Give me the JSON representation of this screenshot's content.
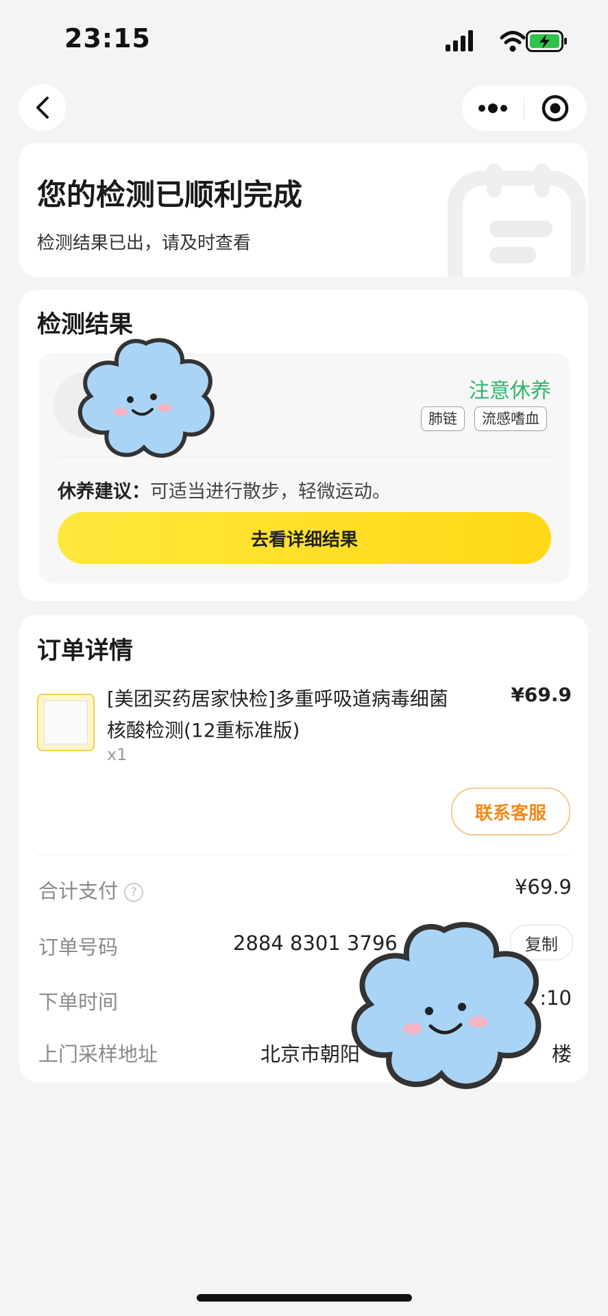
{
  "status_bar": {
    "time": "23:15"
  },
  "header": {
    "back_icon": "chevron-left-icon",
    "menu_icon": "more-dots-icon",
    "close_icon": "target-circle-icon"
  },
  "banner": {
    "title": "您的检测已顺利完成",
    "subtitle": "检测结果已出，请及时查看"
  },
  "result": {
    "section_title": "检测结果",
    "status": "注意休养",
    "status_color": "#2fb46c",
    "tags": [
      "肺链",
      "流感嗜血"
    ],
    "advice_label": "休养建议：",
    "advice_text": "可适当进行散步，轻微运动。",
    "button_label": "去看详细结果",
    "button_color": "#ffe22a"
  },
  "order": {
    "section_title": "订单详情",
    "product_name_line1": "[美团买药居家快检]多重呼吸道病毒细菌",
    "product_name_line2": "核酸检测(12重标准版)",
    "price": "¥69.9",
    "quantity": "x1",
    "contact_button": "联系客服",
    "contact_color": "#f08a1b",
    "total_label": "合计支付",
    "total_value": "¥69.9",
    "order_no_label": "订单号码",
    "order_no_value": "2884 8301 3796",
    "copy_button": "复制",
    "time_label": "下单时间",
    "time_value_visible": ":10",
    "address_label": "上门采样地址",
    "address_value_left": "北京市朝阳",
    "address_value_right": "楼"
  },
  "stickers": [
    "cloud-sticker",
    "cloud-sticker"
  ]
}
